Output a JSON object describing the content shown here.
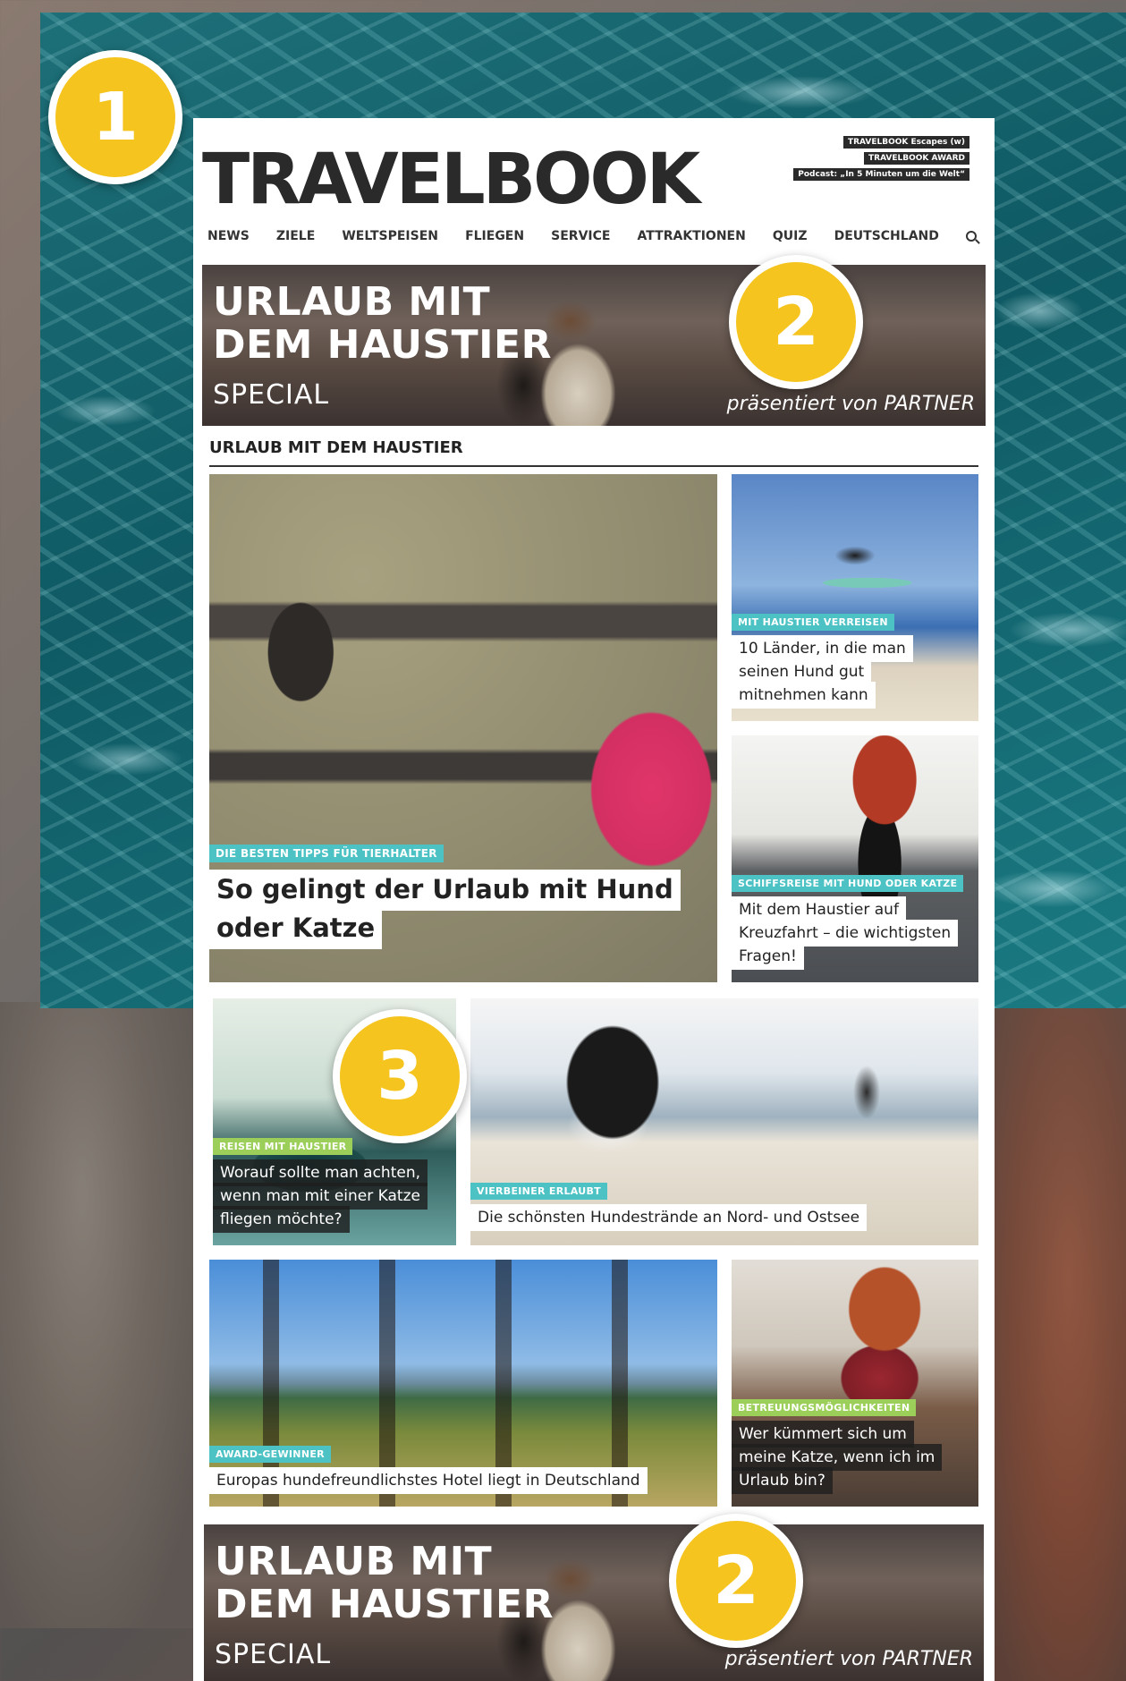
{
  "header": {
    "logo": "TRAVELBOOK",
    "top_links": [
      "TRAVELBOOK Escapes (w)",
      "TRAVELBOOK AWARD",
      "Podcast: „In 5 Minuten um die Welt“"
    ]
  },
  "nav": {
    "items": [
      "NEWS",
      "ZIELE",
      "WELTSPEISEN",
      "FLIEGEN",
      "SERVICE",
      "ATTRAKTIONEN",
      "QUIZ",
      "DEUTSCHLAND"
    ],
    "search_icon": "search-icon"
  },
  "banner": {
    "title_line1": "URLAUB MIT",
    "title_line2": "DEM HAUSTIER",
    "subtitle": "SPECIAL",
    "partner": "präsentiert von PARTNER"
  },
  "section": {
    "title": "URLAUB MIT DEM HAUSTIER"
  },
  "articles": [
    {
      "tag": "DIE BESTEN TIPPS FÜR TIERHALTER",
      "title_line1": "So gelingt der Urlaub mit Hund",
      "title_line2": "oder Katze"
    },
    {
      "tag": "MIT HAUSTIER VERREISEN",
      "title_line1": "10 Länder, in die man",
      "title_line2": "seinen Hund gut",
      "title_line3": "mitnehmen kann"
    },
    {
      "tag": "SCHIFFSREISE MIT HUND ODER KATZE",
      "title_line1": "Mit dem Haustier auf",
      "title_line2": "Kreuzfahrt – die wichtigsten",
      "title_line3": "Fragen!"
    },
    {
      "tag": "REISEN MIT HAUSTIER",
      "title_line1": "Worauf sollte man achten,",
      "title_line2": "wenn man mit einer Katze",
      "title_line3": "fliegen möchte?"
    },
    {
      "tag": "VIERBEINER ERLAUBT",
      "title_line1": "Die schönsten Hundestrände an Nord- und Ostsee"
    },
    {
      "tag": "AWARD-GEWINNER",
      "title_line1": "Europas hundefreundlichstes Hotel liegt in Deutschland"
    },
    {
      "tag": "BETREUUNGSMÖGLICHKEITEN",
      "title_line1": "Wer kümmert sich um",
      "title_line2": "meine Katze, wenn ich im",
      "title_line3": "Urlaub bin?"
    }
  ],
  "badges": [
    "1",
    "2",
    "3",
    "2"
  ],
  "colors": {
    "badge": "#f5c41f",
    "tag_teal": "#4cc2c4",
    "tag_green": "#9bcf5a",
    "text_dark": "#2a2a2a"
  }
}
